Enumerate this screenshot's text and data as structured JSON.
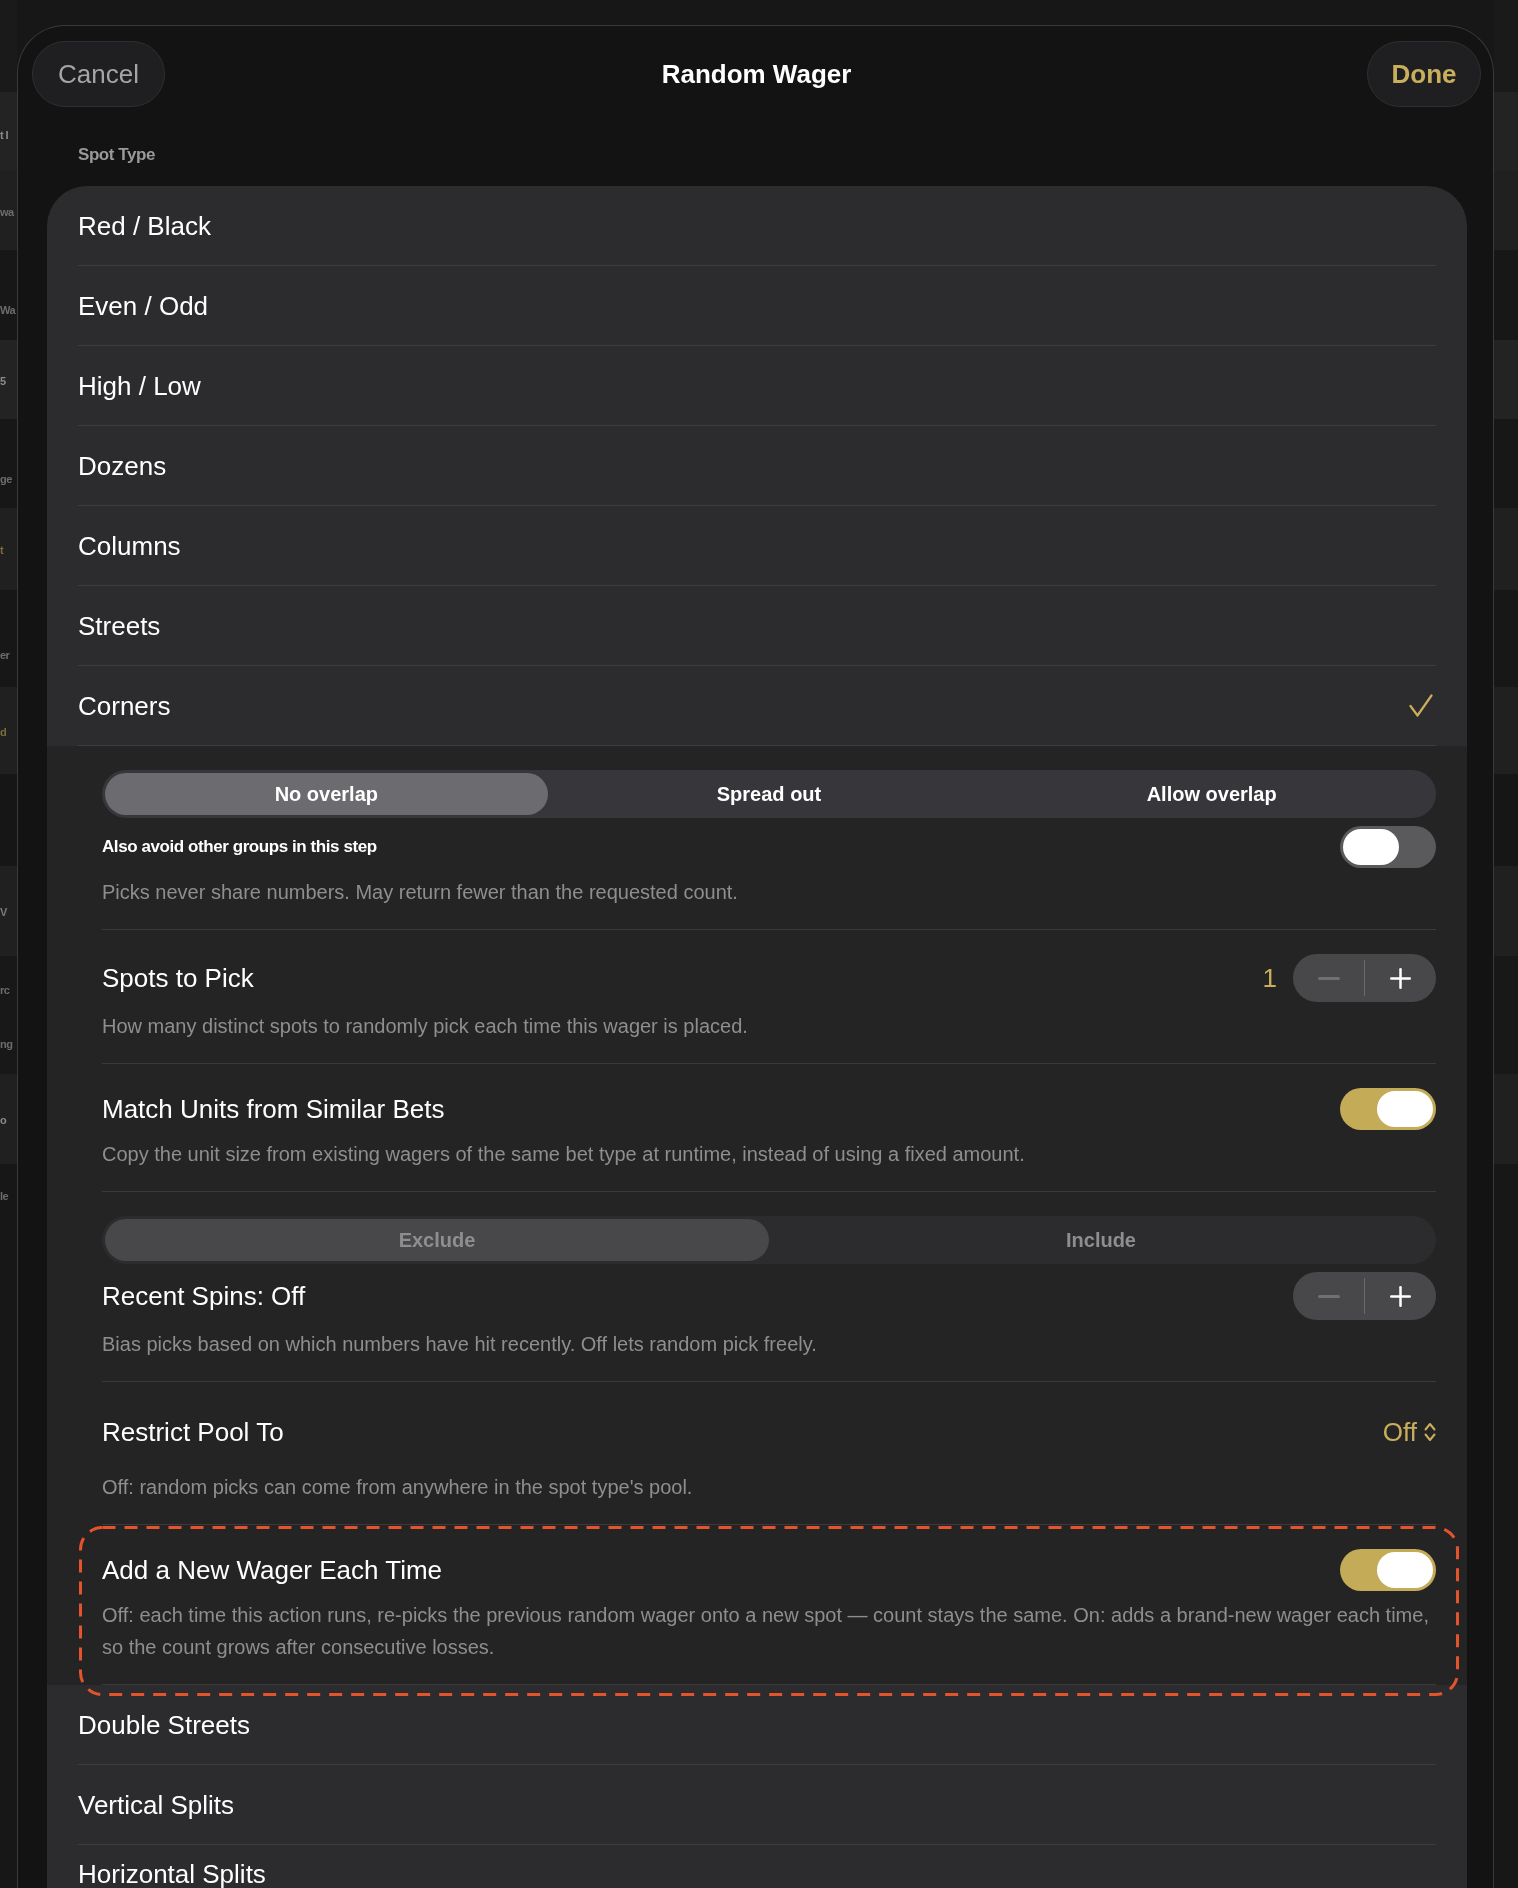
{
  "background_page": {
    "row_fragments": [
      {
        "text": "t I",
        "color": "#8c8c8c"
      },
      {
        "text": "wa",
        "color": "#6c6c6c"
      },
      {
        "text": "Wa",
        "color": "#6c6c6c"
      },
      {
        "text": "5",
        "color": "#8c8c8c"
      },
      {
        "text": "ge",
        "color": "#6c6c6c"
      },
      {
        "text": "t",
        "color": "#7d6c3a"
      },
      {
        "text": "er",
        "color": "#6c6c6c"
      },
      {
        "text": "d",
        "color": "#7d6c3a"
      },
      {
        "text": "V",
        "color": "#7a7a7a"
      },
      {
        "text": "rc",
        "color": "#6c6c6c"
      },
      {
        "text": "ng",
        "color": "#6c6c6c"
      },
      {
        "text": "o",
        "color": "#8a8a8a"
      },
      {
        "text": "le",
        "color": "#6c6c6c"
      }
    ]
  },
  "sheet": {
    "cancel_button": "Cancel",
    "title": "Random Wager",
    "done_button": "Done",
    "section_header": "Spot Type",
    "spot_types": [
      {
        "label": "Red / Black",
        "selected": false
      },
      {
        "label": "Even / Odd",
        "selected": false
      },
      {
        "label": "High / Low",
        "selected": false
      },
      {
        "label": "Dozens",
        "selected": false
      },
      {
        "label": "Columns",
        "selected": false
      },
      {
        "label": "Streets",
        "selected": false
      },
      {
        "label": "Corners",
        "selected": true,
        "options": [
          {
            "kind": "segmented",
            "disabled": false,
            "segments": [
              {
                "label": "No overlap",
                "selected": true
              },
              {
                "label": "Spread out",
                "selected": false
              },
              {
                "label": "Allow overlap",
                "selected": false
              }
            ]
          },
          {
            "kind": "subtoggle",
            "title": "Also avoid other groups in this step",
            "on": false,
            "description": "Picks never share numbers. May return fewer than the requested count."
          },
          {
            "kind": "stepper",
            "title": "Spots to Pick",
            "value": "1",
            "decrement_enabled": false,
            "increment_enabled": true,
            "description": "How many distinct spots to randomly pick each time this wager is placed."
          },
          {
            "kind": "toggle",
            "title": "Match Units from Similar Bets",
            "on": true,
            "description": "Copy the unit size from existing wagers of the same bet type at runtime, instead of using a fixed amount."
          },
          {
            "kind": "segmented",
            "disabled": true,
            "segments": [
              {
                "label": "Exclude",
                "selected": true
              },
              {
                "label": "Include",
                "selected": false
              }
            ]
          },
          {
            "kind": "stepper",
            "title": "Recent Spins: Off",
            "decrement_enabled": false,
            "increment_enabled": true,
            "description": "Bias picks based on which numbers have hit recently. Off lets random pick freely."
          },
          {
            "kind": "picker",
            "title": "Restrict Pool To",
            "value": "Off",
            "description": "Off: random picks can come from anywhere in the spot type's pool."
          },
          {
            "kind": "toggle",
            "title": "Add a New Wager Each Time",
            "on": true,
            "highlighted": true,
            "description": "Off: each time this action runs, re-picks the previous random wager onto a new spot — count stays the same. On: adds a brand-new wager each time, so the count grows after consecutive losses."
          }
        ]
      },
      {
        "label": "Double Streets",
        "selected": false
      },
      {
        "label": "Vertical Splits",
        "selected": false
      },
      {
        "label": "Horizontal Splits",
        "selected": false
      }
    ]
  }
}
